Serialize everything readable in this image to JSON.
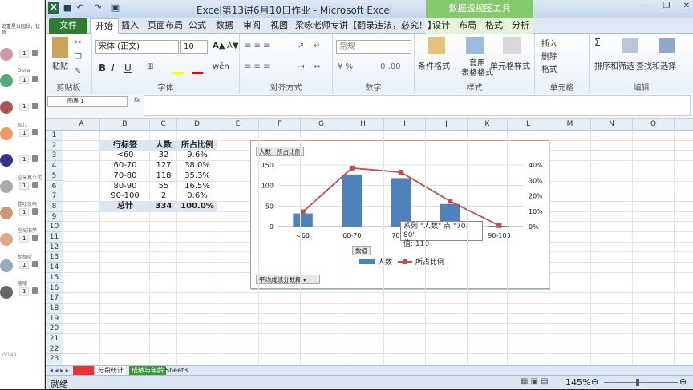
{
  "left_panel": {
    "top_text": "追重星公园社，快哥",
    "items": [
      {
        "name": "",
        "count": "1"
      },
      {
        "name": "Doka",
        "count": "1"
      },
      {
        "name": "",
        "count": "1"
      },
      {
        "name": "现儿",
        "count": "1"
      },
      {
        "name": "",
        "count": "1"
      },
      {
        "name": "@米萬公司",
        "count": "1"
      },
      {
        "name": "是吃货吗",
        "count": "1"
      },
      {
        "name": "空城旧梦",
        "count": "1"
      },
      {
        "name": "胡胡听",
        "count": "1"
      },
      {
        "name": "嗑嗑",
        "count": "1"
      }
    ],
    "footer": "0/140"
  },
  "excel": {
    "title": "Excel第13讲6月10日作业 - Microsoft Excel",
    "context_tab": "数据透视图工具",
    "tabs": [
      {
        "label": "文件"
      },
      {
        "label": "开始"
      },
      {
        "label": "插入"
      },
      {
        "label": "页面布局"
      },
      {
        "label": "公式"
      },
      {
        "label": "数据"
      },
      {
        "label": "审阅"
      },
      {
        "label": "视图"
      },
      {
        "label": "梁咏老师专讲【翻录违法，必究！】"
      }
    ],
    "context_tabs": [
      {
        "label": "设计"
      },
      {
        "label": "布局"
      },
      {
        "label": "格式"
      },
      {
        "label": "分析"
      }
    ],
    "ribbon": {
      "paste": "粘贴",
      "clipboard": "剪贴板",
      "font_name": "宋体 (正文)",
      "font_size": "10",
      "font_group": "字体",
      "align_group": "对齐方式",
      "number_format": "常规",
      "number_group": "数字",
      "cond_format": "条件格式",
      "table_format": "套用\n表格格式",
      "cell_style": "单元格样式",
      "style_group": "样式",
      "insert": "插入",
      "delete": "删除",
      "format": "格式",
      "cells_group": "单元格",
      "sort_filter": "排序和筛选",
      "find_select": "查找和选择",
      "edit_group": "编辑",
      "bold": "B",
      "italic": "I",
      "underline": "U"
    },
    "name_box": "图表 1",
    "fx": "fx",
    "columns": [
      "A",
      "B",
      "C",
      "D",
      "E",
      "F",
      "G",
      "H",
      "I",
      "J",
      "K",
      "L",
      "M",
      "N",
      "O"
    ],
    "rows": [
      "1",
      "2",
      "3",
      "4",
      "5",
      "6",
      "7",
      "8",
      "9",
      "10",
      "11",
      "12",
      "13",
      "14",
      "15",
      "16",
      "17",
      "18",
      "19",
      "20",
      "21",
      "22",
      "23"
    ],
    "pivot": {
      "headers": [
        "行标签",
        "人数",
        "所占比例"
      ],
      "rows": [
        [
          "<60",
          "32",
          "9.6%"
        ],
        [
          "60-70",
          "127",
          "38.0%"
        ],
        [
          "70-80",
          "118",
          "35.3%"
        ],
        [
          "80-90",
          "55",
          "16.5%"
        ],
        [
          "90-100",
          "2",
          "0.6%"
        ]
      ],
      "total": [
        "总计",
        "334",
        "100.0%"
      ]
    },
    "chart_filters": [
      "人数",
      "所占比例"
    ],
    "value_button": "数值",
    "axis_field_button": "平均成绩分数段",
    "tooltip": {
      "line1": "系列 \"人数\" 点 \"70-80\"",
      "line2": "值: 118"
    },
    "sheet_tabs": [
      "分段统计",
      "成绩与年龄",
      "Sheet3"
    ],
    "status": "就绪",
    "zoom": "145%"
  },
  "chart_data": {
    "type": "bar",
    "categories": [
      "<60",
      "60-70",
      "70-80",
      "80-90",
      "90-100"
    ],
    "series": [
      {
        "name": "人数",
        "type": "bar",
        "values": [
          32,
          127,
          118,
          55,
          2
        ],
        "color": "#4f81bd"
      },
      {
        "name": "所占比例",
        "type": "line",
        "values": [
          9.6,
          38.0,
          35.3,
          16.5,
          0.6
        ],
        "color": "#c0504d",
        "axis": "secondary"
      }
    ],
    "y_ticks": [
      "0",
      "50",
      "100",
      "150"
    ],
    "ylim": [
      0,
      150
    ],
    "y2_ticks": [
      "0%",
      "10%",
      "20%",
      "30%",
      "40%"
    ],
    "y2lim": [
      0,
      40
    ],
    "legend_position": "bottom"
  }
}
